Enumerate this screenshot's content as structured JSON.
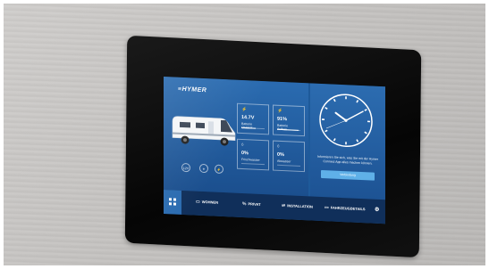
{
  "brand": "≡HYMER",
  "tiles": [
    {
      "icon": "battery-icon",
      "glyph": "⚡",
      "value": "14.7V",
      "label": "Batterie\nChassis",
      "fill": 0.6
    },
    {
      "icon": "battery-icon",
      "glyph": "⚡",
      "value": "91%",
      "label": "Batterie\nAufbau",
      "fill": 0.91
    },
    {
      "icon": "water-drop-icon",
      "glyph": "◊",
      "value": "0%",
      "label": "Frischwasser",
      "fill": 0.0
    },
    {
      "icon": "water-drop-icon",
      "glyph": "◊",
      "value": "0%",
      "label": "Abwasser",
      "fill": 0.0
    }
  ],
  "status_buttons": [
    "12V"
  ],
  "clock": {
    "hour": 10,
    "minute": 10,
    "second": 41
  },
  "info_text": "Informieren Sie sich, was Sie mit der Hymer Connect App alles machen können.",
  "connect_button": "Verbindung",
  "nav": [
    {
      "icon": "wohnen-icon",
      "glyph": "▭",
      "label": "WOHNEN"
    },
    {
      "icon": "privat-icon",
      "glyph": "%",
      "label": "PRIVAT"
    },
    {
      "icon": "installation-icon",
      "glyph": "⇌",
      "label": "INSTALLATION"
    },
    {
      "icon": "vehicle-details-icon",
      "glyph": "▭",
      "label": "FAHRZEUGDETAILS"
    }
  ],
  "colors": {
    "screen": "#1e5a9a",
    "nav": "#102f5a",
    "accent": "#5fb0e8"
  }
}
